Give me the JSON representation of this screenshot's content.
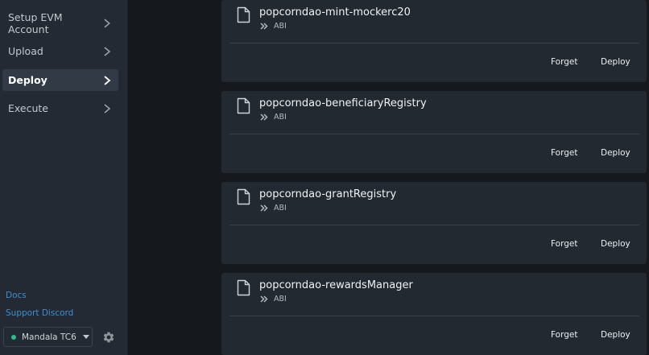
{
  "sidebar": {
    "nav": [
      {
        "label": "Setup EVM Account",
        "active": false
      },
      {
        "label": "Upload",
        "active": false
      },
      {
        "label": "Deploy",
        "active": true
      },
      {
        "label": "Execute",
        "active": false
      }
    ],
    "links": {
      "docs": "Docs",
      "support": "Support Discord"
    },
    "network": {
      "label": "Mandala TC6",
      "status_color": "#25c28a"
    }
  },
  "contracts": [
    {
      "name": "popcorndao-mint-mockerc20",
      "abi_label": "ABI",
      "forget_label": "Forget",
      "deploy_label": "Deploy"
    },
    {
      "name": "popcorndao-beneficiaryRegistry",
      "abi_label": "ABI",
      "forget_label": "Forget",
      "deploy_label": "Deploy"
    },
    {
      "name": "popcorndao-grantRegistry",
      "abi_label": "ABI",
      "forget_label": "Forget",
      "deploy_label": "Deploy"
    },
    {
      "name": "popcorndao-rewardsManager",
      "abi_label": "ABI",
      "forget_label": "Forget",
      "deploy_label": "Deploy"
    }
  ],
  "icons": {
    "chevron": "chevron-right-icon",
    "file": "file-icon",
    "abi": "double-chevron-right-icon",
    "settings": "gear-icon",
    "dropdown": "caret-down-icon"
  },
  "colors": {
    "sidebar_bg": "#232a33",
    "card_bg": "#222931",
    "page_bg": "#15191e",
    "link": "#3d8fd1",
    "active_item_bg": "#313a45"
  }
}
